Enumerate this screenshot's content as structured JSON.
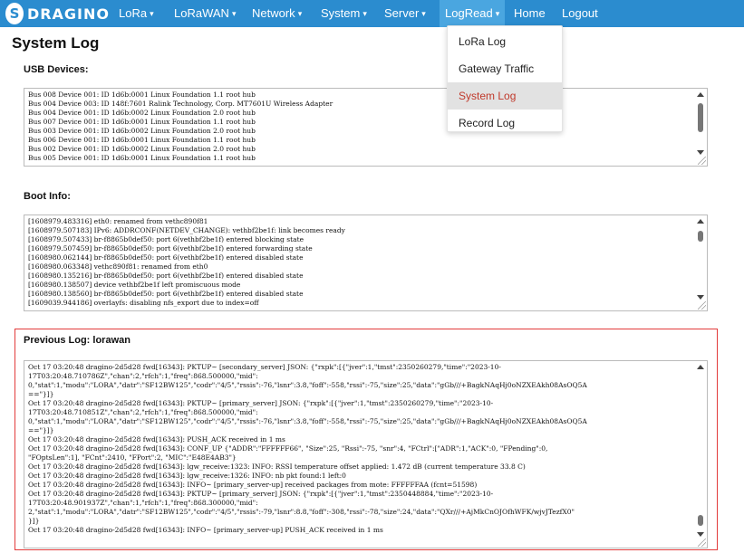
{
  "nav": {
    "logo_mark": "S",
    "logo_text": "DRAGINO",
    "items": [
      {
        "label": "LoRa",
        "caret": "▾"
      },
      {
        "label": "LoRaWAN",
        "caret": "▾"
      },
      {
        "label": "Network",
        "caret": "▾"
      },
      {
        "label": "System",
        "caret": "▾"
      },
      {
        "label": "Server",
        "caret": "▾"
      },
      {
        "label": "LogRead",
        "caret": "▾"
      },
      {
        "label": "Home"
      },
      {
        "label": "Logout"
      }
    ],
    "dropdown": [
      "LoRa Log",
      "Gateway Traffic",
      "System Log",
      "Record Log"
    ]
  },
  "page": {
    "title": "System Log",
    "usb_label": "USB Devices:",
    "boot_label": "Boot Info:",
    "prev_label": "Previous Log: lorawan"
  },
  "usb_lines": [
    "Bus 008 Device 001: ID 1d6b:0001 Linux Foundation 1.1 root hub",
    "Bus 004 Device 003: ID 148f:7601 Ralink Technology, Corp. MT7601U Wireless Adapter",
    "Bus 004 Device 001: ID 1d6b:0002 Linux Foundation 2.0 root hub",
    "Bus 007 Device 001: ID 1d6b:0001 Linux Foundation 1.1 root hub",
    "Bus 003 Device 001: ID 1d6b:0002 Linux Foundation 2.0 root hub",
    "Bus 006 Device 001: ID 1d6b:0001 Linux Foundation 1.1 root hub",
    "Bus 002 Device 001: ID 1d6b:0002 Linux Foundation 2.0 root hub",
    "Bus 005 Device 001: ID 1d6b:0001 Linux Foundation 1.1 root hub"
  ],
  "boot_lines": [
    "[1608979.483316] eth0: renamed from vethc890f81",
    "[1608979.507183] IPv6: ADDRCONF(NETDEV_CHANGE): vethbf2be1f: link becomes ready",
    "[1608979.507433] br-f8865b0def50: port 6(vethbf2be1f) entered blocking state",
    "[1608979.507459] br-f8865b0def50: port 6(vethbf2be1f) entered forwarding state",
    "[1608980.062144] br-f8865b0def50: port 6(vethbf2be1f) entered disabled state",
    "[1608980.063348] vethc890f81: renamed from eth0",
    "[1608980.135216] br-f8865b0def50: port 6(vethbf2be1f) entered disabled state",
    "[1608980.138507] device vethbf2be1f left promiscuous mode",
    "[1608980.138560] br-f8865b0def50: port 6(vethbf2be1f) entered disabled state",
    "[1609039.944186] overlayfs: disabling nfs_export due to index=off"
  ],
  "prev_lines": [
    "Oct 17 03:20:48 dragino-2d5d28 fwd[16343]: PKTUP~ [secondary_server] JSON: {\"rxpk\":[{\"jver\":1,\"tmst\":2350260279,\"time\":\"2023-10-",
    "17T03:20:48.710786Z\",\"chan\":2,\"rfch\":1,\"freq\":868.500000,\"mid\":",
    "0,\"stat\":1,\"modu\":\"LORA\",\"datr\":\"SF12BW125\",\"codr\":\"4/5\",\"rssis\":-76,\"lsnr\":3.8,\"foff\":-558,\"rssi\":-75,\"size\":25,\"data\":\"gGb///+BagkNAqHj0oNZXEAkh08AsOQ5A",
    "==\"}]}",
    "Oct 17 03:20:48 dragino-2d5d28 fwd[16343]: PKTUP~ [primary_server] JSON: {\"rxpk\":[{\"jver\":1,\"tmst\":2350260279,\"time\":\"2023-10-",
    "17T03:20:48.710851Z\",\"chan\":2,\"rfch\":1,\"freq\":868.500000,\"mid\":",
    "0,\"stat\":1,\"modu\":\"LORA\",\"datr\":\"SF12BW125\",\"codr\":\"4/5\",\"rssis\":-76,\"lsnr\":3.8,\"foff\":-558,\"rssi\":-75,\"size\":25,\"data\":\"gGb///+BagkNAqHj0oNZXEAkh08AsOQ5A",
    "==\"}]}",
    "Oct 17 03:20:48 dragino-2d5d28 fwd[16343]: PUSH_ACK received in 1 ms",
    "Oct 17 03:20:48 dragino-2d5d28 fwd[16343]: CONF_UP {\"ADDR\":\"FFFFFF66\", \"Size\":25, \"Rssi\":-75, \"snr\":4, \"FCtrl\":[\"ADR\":1,\"ACK\":0, \"FPending\":0,",
    "\"FOptsLen\":1], \"FCnt\":2410, \"FPort\":2, \"MIC\":\"E48E4AB3\"}",
    "Oct 17 03:20:48 dragino-2d5d28 fwd[16343]: lgw_receive:1323: INFO: RSSI temperature offset applied: 1.472 dB (current temperature 33.8 C)",
    "Oct 17 03:20:48 dragino-2d5d28 fwd[16343]: lgw_receive:1326: INFO: nb pkt found:1 left:0",
    "Oct 17 03:20:48 dragino-2d5d28 fwd[16343]: INFO~ [primary_server-up] received packages from mote: FFFFFFAA (fcnt=51598)",
    "Oct 17 03:20:48 dragino-2d5d28 fwd[16343]: PKTUP~ [primary_server] JSON: {\"rxpk\":[{\"jver\":1,\"tmst\":2350448884,\"time\":\"2023-10-",
    "17T03:20:48.901937Z\",\"chan\":1,\"rfch\":1,\"freq\":868.300000,\"mid\":",
    "2,\"stat\":1,\"modu\":\"LORA\",\"datr\":\"SF12BW125\",\"codr\":\"4/5\",\"rssis\":-79,\"lsnr\":8.8,\"foff\":-308,\"rssi\":-78,\"size\":24,\"data\":\"QXr///+AjMkCnOJOfhWFK/wjvJTezfX0\"",
    "}]}",
    "Oct 17 03:20:48 dragino-2d5d28 fwd[16343]: INFO~ [primary_server-up] PUSH_ACK received in 1 ms"
  ]
}
